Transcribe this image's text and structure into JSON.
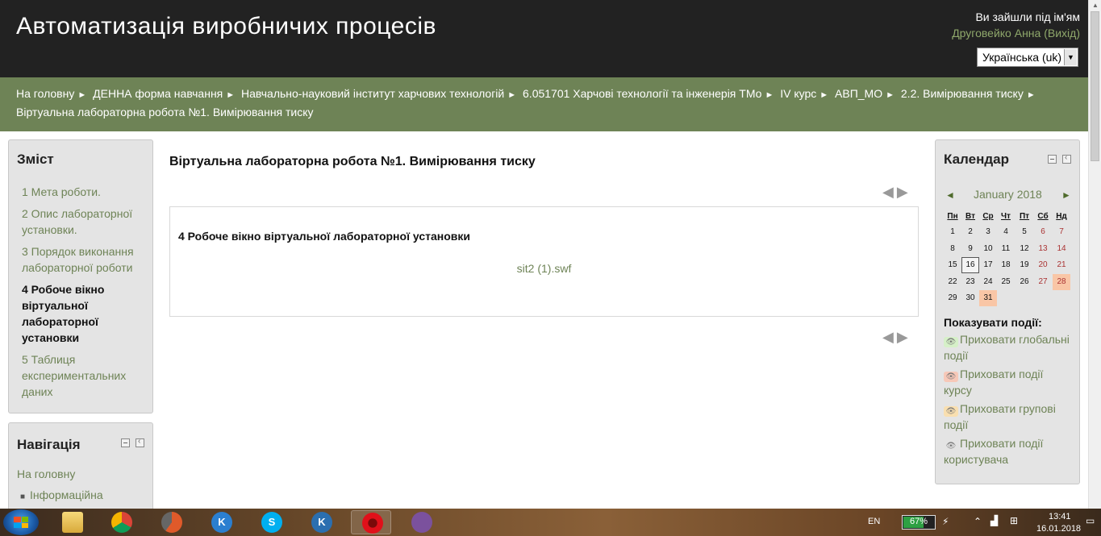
{
  "header": {
    "site_title": "Автоматизація виробничих процесів",
    "login_label": "Ви зайшли під ім'ям",
    "user_name": "Друговейко Анна",
    "logout_label": "Вихід",
    "language": "Українська (uk)"
  },
  "breadcrumb": [
    "На головну",
    "ДЕННА форма навчання",
    "Навчально-науковий інститут харчових технологій",
    "6.051701 Харчові технології та інженерія ТМо",
    "IV курс",
    "АВП_МО",
    "2.2. Вимірювання тиску",
    "Віртуальна лабораторна робота №1. Вимірювання тиску"
  ],
  "toc": {
    "title": "Зміст",
    "items": [
      "1 Мета роботи.",
      "2 Опис лабораторної установки.",
      "3 Порядок виконання лабораторної роботи",
      "4 Робоче вікно віртуальної лабораторної установки",
      "5 Таблиця експериментальних даних"
    ],
    "current_index": 3
  },
  "navigation": {
    "title": "Навігація",
    "home": "На головну",
    "item": "Інформаційна"
  },
  "main": {
    "page_title": "Віртуальна лабораторна робота №1. Вимірювання тиску",
    "section_title": "4 Робоче вікно віртуальної лабораторної установки",
    "file_link": "sit2 (1).swf",
    "prev_arrow": "◀",
    "next_arrow": "▶"
  },
  "calendar": {
    "title": "Календар",
    "month": "January 2018",
    "prev": "◄",
    "next": "►",
    "weekdays": [
      "Пн",
      "Вт",
      "Ср",
      "Чт",
      "Пт",
      "Сб",
      "Нд"
    ],
    "weeks": [
      [
        "1",
        "2",
        "3",
        "4",
        "5",
        "6",
        "7"
      ],
      [
        "8",
        "9",
        "10",
        "11",
        "12",
        "13",
        "14"
      ],
      [
        "15",
        "16",
        "17",
        "18",
        "19",
        "20",
        "21"
      ],
      [
        "22",
        "23",
        "24",
        "25",
        "26",
        "27",
        "28"
      ],
      [
        "29",
        "30",
        "31",
        "",
        "",
        "",
        ""
      ]
    ],
    "today": "16",
    "course_event_days": [
      "28",
      "31"
    ],
    "show_events_label": "Показувати події:",
    "event_links": [
      "Приховати глобальні події",
      "Приховати події курсу",
      "Приховати групові події",
      "Приховати події користувача"
    ]
  },
  "taskbar": {
    "language": "EN",
    "battery": "67%",
    "battery_level": 0.67,
    "time": "13:41",
    "date": "16.01.2018"
  },
  "colors": {
    "header_bg": "#222222",
    "navbar_bg": "#6e8356",
    "link": "#6e8356",
    "block_bg": "#e4e4e4"
  }
}
